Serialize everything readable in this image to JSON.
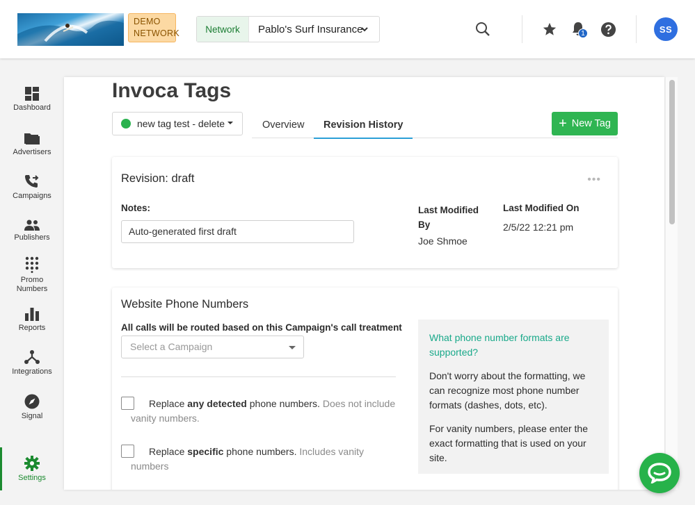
{
  "header": {
    "demo_badge_line1": "DEMO",
    "demo_badge_line2": "NETWORK",
    "network_label": "Network",
    "network_value": "Pablo's Surf Insurance",
    "notification_count": "1",
    "avatar_initials": "SS"
  },
  "sidebar": {
    "items": [
      {
        "label": "Dashboard",
        "icon": "dashboard-icon"
      },
      {
        "label": "Advertisers",
        "icon": "folder-icon"
      },
      {
        "label": "Campaigns",
        "icon": "phone-forward-icon"
      },
      {
        "label": "Publishers",
        "icon": "people-icon"
      },
      {
        "label": "Promo Numbers",
        "icon": "dialpad-icon"
      },
      {
        "label": "Reports",
        "icon": "bar-chart-icon"
      },
      {
        "label": "Integrations",
        "icon": "network-icon"
      },
      {
        "label": "Signal",
        "icon": "compass-icon"
      },
      {
        "label": "Settings",
        "icon": "gear-icon"
      }
    ],
    "active": "Settings"
  },
  "page": {
    "title": "Invoca Tags",
    "tag_select_value": "new tag test - delete",
    "tabs": [
      {
        "label": "Overview",
        "active": false
      },
      {
        "label": "Revision History",
        "active": true
      }
    ],
    "new_tag_label": "New Tag"
  },
  "revision": {
    "title": "Revision: draft",
    "more": "•••",
    "notes_label": "Notes:",
    "notes_value": "Auto-generated first draft",
    "last_modified_by_label_1": "Last Modified",
    "last_modified_by_label_2": "By",
    "last_modified_by_value": "Joe Shmoe",
    "last_modified_on_label": "Last Modified On",
    "last_modified_on_value": "2/5/22 12:21 pm"
  },
  "phones": {
    "title": "Website Phone Numbers",
    "routing_label": "All calls will be routed based on this Campaign's call treatment",
    "campaign_placeholder": "Select a Campaign",
    "option1": {
      "pre": "Replace ",
      "bold": "any detected",
      "post": " phone numbers. ",
      "muted1": "Does not include",
      "muted2": "vanity numbers."
    },
    "option2": {
      "pre": "Replace ",
      "bold": "specific",
      "post": " phone numbers. ",
      "muted1": "Includes vanity",
      "muted2": "numbers"
    },
    "help_question": "What phone number formats are supported?",
    "help_p1": "Don't worry about the formatting, we can recognize most phone number formats (dashes, dots, etc).",
    "help_p2": "For vanity numbers, please enter the exact formatting that is used on your site."
  },
  "colors": {
    "brand_green": "#2fb552",
    "tab_underline": "#2b9fd6",
    "link_teal": "#19a98a",
    "avatar_blue": "#2f6fe0"
  }
}
